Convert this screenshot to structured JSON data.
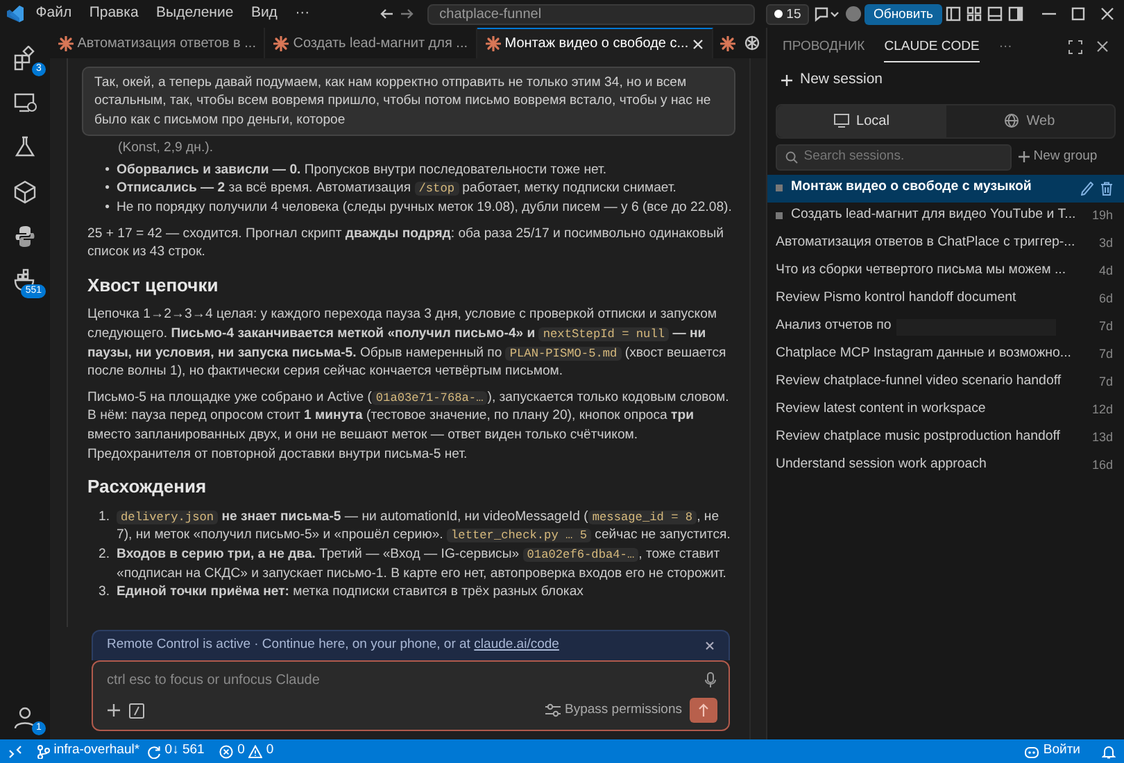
{
  "title_bar": {
    "menu": [
      "Файл",
      "Правка",
      "Выделение",
      "Вид",
      "···"
    ],
    "search": "chatplace-funnel",
    "notifications": "15",
    "update_button": "Обновить"
  },
  "activity_bar": [
    {
      "kind": "extensions",
      "badge": "3"
    },
    {
      "kind": "remote"
    },
    {
      "kind": "flask"
    },
    {
      "kind": "box"
    },
    {
      "kind": "python"
    },
    {
      "kind": "container",
      "badge": "551"
    }
  ],
  "account_badge": "1",
  "tabs": [
    {
      "label": "Автоматизация ответов в ...",
      "selected": false
    },
    {
      "label": "Создать lead-магнит для ...",
      "selected": false
    },
    {
      "label": "Монтаж видео о свободе с...",
      "selected": true
    }
  ],
  "chat": {
    "user_message": "Так, окей, а теперь давай подумаем, как нам корректно отправить не только этим 34, но и всем остальным, так, чтобы всем вовремя пришло, чтобы потом письмо вовремя встало, чтобы у нас не было как с письмом про деньги, которое",
    "blocks": [
      {
        "kind": "continuation",
        "segments": [
          {
            "kind": "text",
            "text": "(Konst, 2,9 дн.)."
          }
        ]
      },
      {
        "kind": "bullets",
        "items": [
          {
            "marker": "•",
            "segments": [
              {
                "kind": "text",
                "text": "**Оборвались и зависли — 0.** Пропусков внутри последовательности тоже нет."
              }
            ]
          },
          {
            "marker": "•",
            "segments": [
              {
                "kind": "text",
                "text": "**Отписались — 2** за всё время. Автоматизация "
              },
              {
                "kind": "code",
                "text": "/stop"
              },
              {
                "kind": "text",
                "text": " работает, метку подписки снимает."
              }
            ]
          },
          {
            "marker": "•",
            "segments": [
              {
                "kind": "text",
                "text": "Не по порядку получили 4 человека (следы ручных меток 19.08), дубли писем — у 6 (все до 22.08)."
              }
            ]
          }
        ]
      },
      {
        "kind": "paragraph",
        "segments": [
          {
            "kind": "text",
            "text": "25 + 17 = 42 — сходится. Прогнал скрипт **дважды подряд**: оба раза 25/17 и посимвольно одинаковый список из 43 строк."
          }
        ]
      },
      {
        "kind": "heading",
        "text": "Хвост цепочки"
      },
      {
        "kind": "paragraph",
        "segments": [
          {
            "kind": "text",
            "text": "Цепочка 1→2→3→4 целая: у каждого перехода пауза 3 дня, условие с проверкой отписки и запуском следующего. **Письмо-4 заканчивается меткой «получил письмо-4» и** "
          },
          {
            "kind": "code",
            "text": "nextStepId = null"
          },
          {
            "kind": "text",
            "text": " **— ни паузы, ни условия, ни запуска письма-5.** Обрыв намеренный по "
          },
          {
            "kind": "code",
            "text": "PLAN-PISMO-5.md"
          },
          {
            "kind": "text",
            "text": " (хвост вешается после волны 1), но фактически серия сейчас кончается четвёртым письмом."
          }
        ]
      },
      {
        "kind": "paragraph",
        "segments": [
          {
            "kind": "text",
            "text": "Письмо-5 на площадке уже собрано и Active ("
          },
          {
            "kind": "code",
            "text": "01a03e71-768a-…"
          },
          {
            "kind": "text",
            "text": "), запускается только кодовым словом. В нём: пауза перед опросом стоит **1 минута** (тестовое значение, по плану 20), кнопок опроса **три** вместо запланированных двух, и они не вешают меток — ответ виден только счётчиком. Предохранителя от повторной доставки внутри письма-5 нет."
          }
        ]
      },
      {
        "kind": "heading",
        "text": "Расхождения"
      },
      {
        "kind": "numbered",
        "items": [
          {
            "marker": "1.",
            "segments": [
              {
                "kind": "code",
                "text": "delivery.json"
              },
              {
                "kind": "text",
                "text": " **не знает письма-5** — ни automationId, ни videoMessageId ("
              },
              {
                "kind": "code",
                "text": "message_id = 8"
              },
              {
                "kind": "text",
                "text": ", не 7), ни меток «получил письмо-5» и «прошёл серию». "
              },
              {
                "kind": "code",
                "text": "letter_check.py … 5"
              },
              {
                "kind": "text",
                "text": " сейчас не запустится."
              }
            ]
          },
          {
            "marker": "2.",
            "segments": [
              {
                "kind": "text",
                "text": "**Входов в серию три, а не два.** Третий — «Вход — IG-сервисы» "
              },
              {
                "kind": "code",
                "text": "01a02ef6-dba4-…"
              },
              {
                "kind": "text",
                "text": ", тоже ставит «подписан на СКДС» и запускает письмо-1. В карте его нет, автопроверка входов его не сторожит."
              }
            ]
          },
          {
            "marker": "3.",
            "segments": [
              {
                "kind": "text",
                "text": "**Единой точки приёма нет:** метка подписки ставится в трёх разных блоках"
              }
            ]
          }
        ]
      }
    ]
  },
  "remote_banner": {
    "text": "Remote Control is active · Continue here, on your phone, or at",
    "link": "claude.ai/code"
  },
  "composer": {
    "placeholder": "ctrl esc to focus or unfocus Claude",
    "mode": "Bypass permissions"
  },
  "side_panel": {
    "tabs": [
      {
        "label": "ПРОВОДНИК",
        "selected": false
      },
      {
        "label": "CLAUDE CODE",
        "selected": true
      }
    ],
    "new_session": "New session",
    "modes": [
      {
        "kind": "local",
        "label": "Local",
        "selected": true
      },
      {
        "kind": "web",
        "label": "Web",
        "selected": false
      }
    ],
    "search_placeholder": "Search sessions.",
    "new_group": "New group",
    "sessions": [
      {
        "title": "Монтаж видео о свободе с музыкой",
        "selected": true,
        "open": true
      },
      {
        "title": "Создать lead-магнит для видео YouTube и T...",
        "time": "19h",
        "selected": false,
        "open": true
      },
      {
        "title": "Автоматизация ответов в ChatPlace с триггер-...",
        "time": "3d",
        "selected": false,
        "open": false
      },
      {
        "title": "Что из сборки четвертого письма мы можем ...",
        "time": "4d",
        "selected": false,
        "open": false
      },
      {
        "title": "Review Pismo kontrol handoff document",
        "time": "6d",
        "selected": false,
        "open": false
      },
      {
        "title": "Анализ отчетов по",
        "time": "7d",
        "selected": false,
        "open": false,
        "redacted": true
      },
      {
        "title": "Chatplace MCP Instagram данные и возможно...",
        "time": "7d",
        "selected": false,
        "open": false
      },
      {
        "title": "Review chatplace-funnel video scenario handoff",
        "time": "7d",
        "selected": false,
        "open": false
      },
      {
        "title": "Review latest content in workspace",
        "time": "12d",
        "selected": false,
        "open": false
      },
      {
        "title": "Review chatplace music postproduction handoff",
        "time": "13d",
        "selected": false,
        "open": false
      },
      {
        "title": "Understand session work approach",
        "time": "16d",
        "selected": false,
        "open": false
      }
    ]
  },
  "status_bar": {
    "branch": "infra-overhaul*",
    "sync": "0↓ 561",
    "errors": "0",
    "warnings": "0",
    "account": "Войти"
  }
}
